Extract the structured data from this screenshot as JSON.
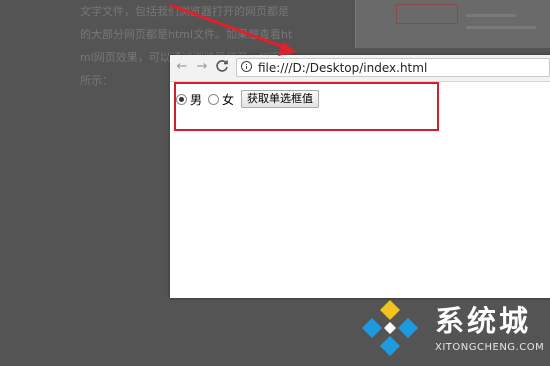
{
  "background_article": {
    "lines": [
      "文字文件，包括我们浏览器打开的网页都是",
      "的大部分网页都是html文件。如果想查看ht",
      "ml网页效果，可以通过浏览器打开，如下图",
      "所示："
    ]
  },
  "browser": {
    "url": "file:///D:/Desktop/index.html",
    "nav": {
      "back": "←",
      "forward": "→",
      "reload": "C"
    }
  },
  "form": {
    "options": [
      {
        "label": "男",
        "checked": true
      },
      {
        "label": "女",
        "checked": false
      }
    ],
    "button_label": "获取单选框值"
  },
  "watermark": {
    "brand": "系统城",
    "domain": "XITONGCHENG.COM"
  },
  "colors": {
    "highlight": "#d0202a",
    "arrow": "#e0202a",
    "logo_blue": "#1e9be0"
  }
}
